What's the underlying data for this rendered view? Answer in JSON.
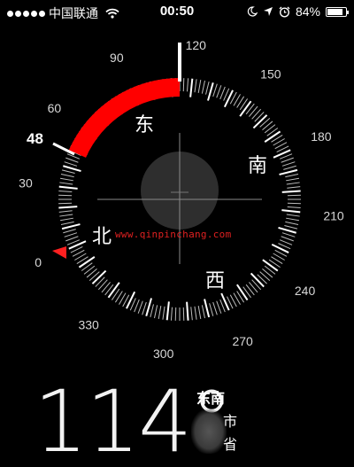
{
  "status_bar": {
    "carrier": "中国联通",
    "time": "00:50",
    "battery": "84%",
    "battery_level": 0.84,
    "icons": [
      "signal-dots-icon",
      "wifi-icon",
      "moon-icon",
      "location-arrow-icon",
      "alarm-icon",
      "battery-icon"
    ]
  },
  "compass": {
    "heading": 114,
    "marker_value": 48,
    "degree_labels": [
      "0",
      "30",
      "60",
      "90",
      "120",
      "150",
      "180",
      "210",
      "240",
      "270",
      "300",
      "330"
    ],
    "cardinals": {
      "east": "东",
      "south": "南",
      "west": "西",
      "north": "北"
    },
    "accent_color": "#ff0000"
  },
  "watermark": "www.qinpinchang.com",
  "readout": {
    "degrees": "114°",
    "direction": "东南",
    "location_line1": "市",
    "location_line2": "省"
  }
}
